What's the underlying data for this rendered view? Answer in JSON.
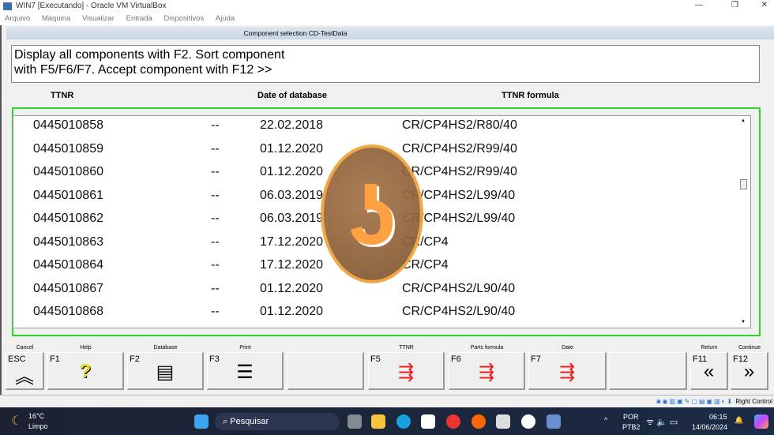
{
  "window": {
    "title": "WIN7 [Executando] - Oracle VM VirtualBox",
    "menu": [
      "Arquivo",
      "Máquina",
      "Visualizar",
      "Entrada",
      "Dispositivos",
      "Ajuda"
    ]
  },
  "app": {
    "header": "Component selection CD-TestData",
    "instructions": [
      "Display all components with F2. Sort component",
      "with F5/F6/F7. Accept component with F12 >>"
    ],
    "columns": {
      "ttnr": "TTNR",
      "date": "Date of database",
      "formula": "TTNR formula"
    },
    "rows": [
      {
        "ttnr": "0445010858",
        "sep": "--",
        "date": "22.02.2018",
        "formula": "CR/CP4HS2/R80/40"
      },
      {
        "ttnr": "0445010859",
        "sep": "--",
        "date": "01.12.2020",
        "formula": "CR/CP4HS2/R99/40"
      },
      {
        "ttnr": "0445010860",
        "sep": "--",
        "date": "01.12.2020",
        "formula": "CR/CP4HS2/R99/40"
      },
      {
        "ttnr": "0445010861",
        "sep": "--",
        "date": "06.03.2019",
        "formula": "CR/CP4HS2/L99/40"
      },
      {
        "ttnr": "0445010862",
        "sep": "--",
        "date": "06.03.2019",
        "formula": "CR/CP4HS2/L99/40"
      },
      {
        "ttnr": "0445010863",
        "sep": "--",
        "date": "17.12.2020",
        "formula": "CR/CP4"
      },
      {
        "ttnr": "0445010864",
        "sep": "--",
        "date": "17.12.2020",
        "formula": "CR/CP4"
      },
      {
        "ttnr": "0445010867",
        "sep": "--",
        "date": "01.12.2020",
        "formula": "CR/CP4HS2/L90/40"
      },
      {
        "ttnr": "0445010868",
        "sep": "--",
        "date": "01.12.2020",
        "formula": "CR/CP4HS2/L90/40"
      }
    ],
    "buttons": [
      {
        "key": "ESC",
        "label": "Cancel",
        "icon": "chevron-up-icon",
        "glyph": "︽"
      },
      {
        "key": "F1",
        "label": "Help",
        "icon": "help-icon",
        "glyph": "?"
      },
      {
        "key": "F2",
        "label": "Database",
        "icon": "documents-icon",
        "glyph": "▤"
      },
      {
        "key": "F3",
        "label": "Print",
        "icon": "print-list-icon",
        "glyph": "☰"
      },
      {
        "key": "",
        "label": "",
        "icon": "",
        "glyph": ""
      },
      {
        "key": "F5",
        "label": "TTNR",
        "icon": "sort-icon",
        "glyph": "⇶"
      },
      {
        "key": "F6",
        "label": "Parts formula",
        "icon": "sort-icon",
        "glyph": "⇶"
      },
      {
        "key": "F7",
        "label": "Date",
        "icon": "sort-icon",
        "glyph": "⇶"
      },
      {
        "key": "",
        "label": "",
        "icon": "",
        "glyph": ""
      },
      {
        "key": "F11",
        "label": "Return",
        "icon": "double-chevron-left-icon",
        "glyph": "«"
      },
      {
        "key": "F12",
        "label": "Continue",
        "icon": "double-chevron-right-icon",
        "glyph": "»"
      }
    ]
  },
  "statusbar": {
    "host_key": "Right Control"
  },
  "taskbar": {
    "weather_temp": "16°C",
    "weather_desc": "Limpo",
    "search": "Pesquisar",
    "lang1": "POR",
    "lang2": "PTB2",
    "time": "06:15",
    "date": "14/06/2024"
  }
}
